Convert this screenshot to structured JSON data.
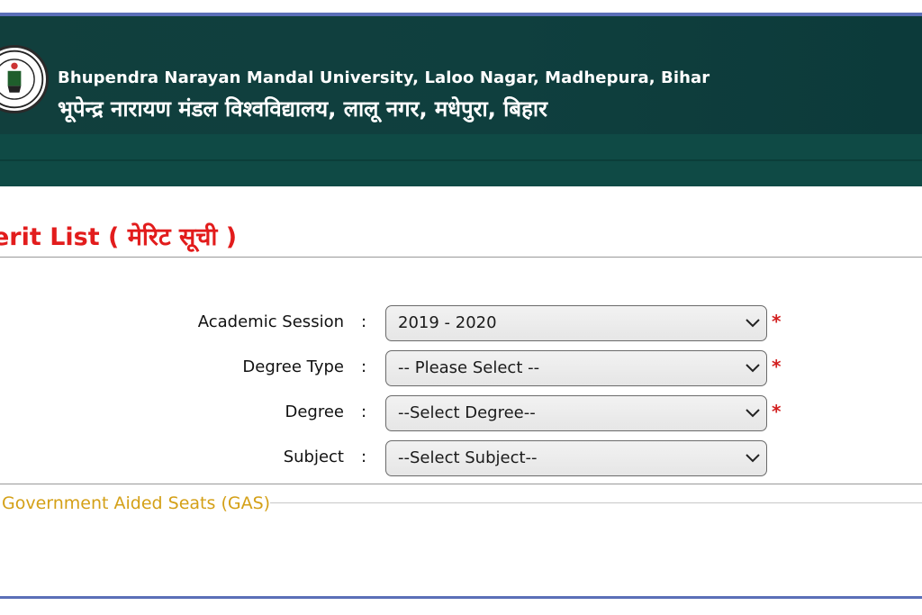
{
  "header": {
    "title_en": "Bhupendra Narayan Mandal University, Laloo Nagar, Madhepura, Bihar",
    "title_hi": "भूपेन्द्र नारायण मंडल विश्वविद्यालय, लालू नगर, मधेपुरा, बिहार",
    "logo_icon": "university-seal-icon"
  },
  "page": {
    "title": "erit List ( मेरिट सूची )"
  },
  "form": {
    "fields": [
      {
        "label": "Academic Session",
        "colon": ":",
        "value": "2019 - 2020",
        "required": "*"
      },
      {
        "label": "Degree Type",
        "colon": ":",
        "value": "-- Please Select --",
        "required": "*"
      },
      {
        "label": "Degree",
        "colon": ":",
        "value": "--Select Degree--",
        "required": "*"
      },
      {
        "label": "Subject",
        "colon": ":",
        "value": "--Select Subject--",
        "required": ""
      }
    ]
  },
  "section": {
    "legend": "Government Aided Seats (GAS)"
  },
  "colors": {
    "header_bg": "#0f3f3e",
    "title_red": "#e21c1c",
    "legend_gold": "#d4a017",
    "required_red": "#d21f1f",
    "accent_line": "#5b6fb8"
  }
}
